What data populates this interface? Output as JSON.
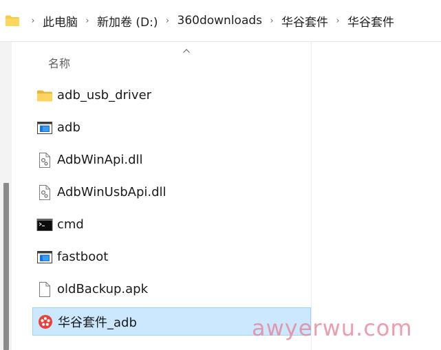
{
  "breadcrumb": {
    "items": [
      {
        "label": "此电脑"
      },
      {
        "label": "新加卷 (D:)"
      },
      {
        "label": "360downloads"
      },
      {
        "label": "华谷套件"
      },
      {
        "label": "华谷套件"
      }
    ],
    "separator": "›"
  },
  "filelist": {
    "column_header": "名称",
    "sort_indicator": "ascending",
    "items": [
      {
        "name": "adb_usb_driver",
        "icon": "folder-icon",
        "selected": false
      },
      {
        "name": "adb",
        "icon": "application-icon",
        "selected": false
      },
      {
        "name": "AdbWinApi.dll",
        "icon": "dll-file-icon",
        "selected": false
      },
      {
        "name": "AdbWinUsbApi.dll",
        "icon": "dll-file-icon",
        "selected": false
      },
      {
        "name": "cmd",
        "icon": "terminal-icon",
        "selected": false
      },
      {
        "name": "fastboot",
        "icon": "application-icon",
        "selected": false
      },
      {
        "name": "oldBackup.apk",
        "icon": "blank-file-icon",
        "selected": false
      },
      {
        "name": "华谷套件_adb",
        "icon": "red-flower-app-icon",
        "selected": true
      }
    ]
  },
  "watermark": "awyerwu.com",
  "colors": {
    "selection_bg": "#cce8ff",
    "selection_border": "#99d1ff",
    "folder_yellow": "#f8c94a",
    "app_blue": "#1a73d6",
    "watermark": "#e88096"
  }
}
